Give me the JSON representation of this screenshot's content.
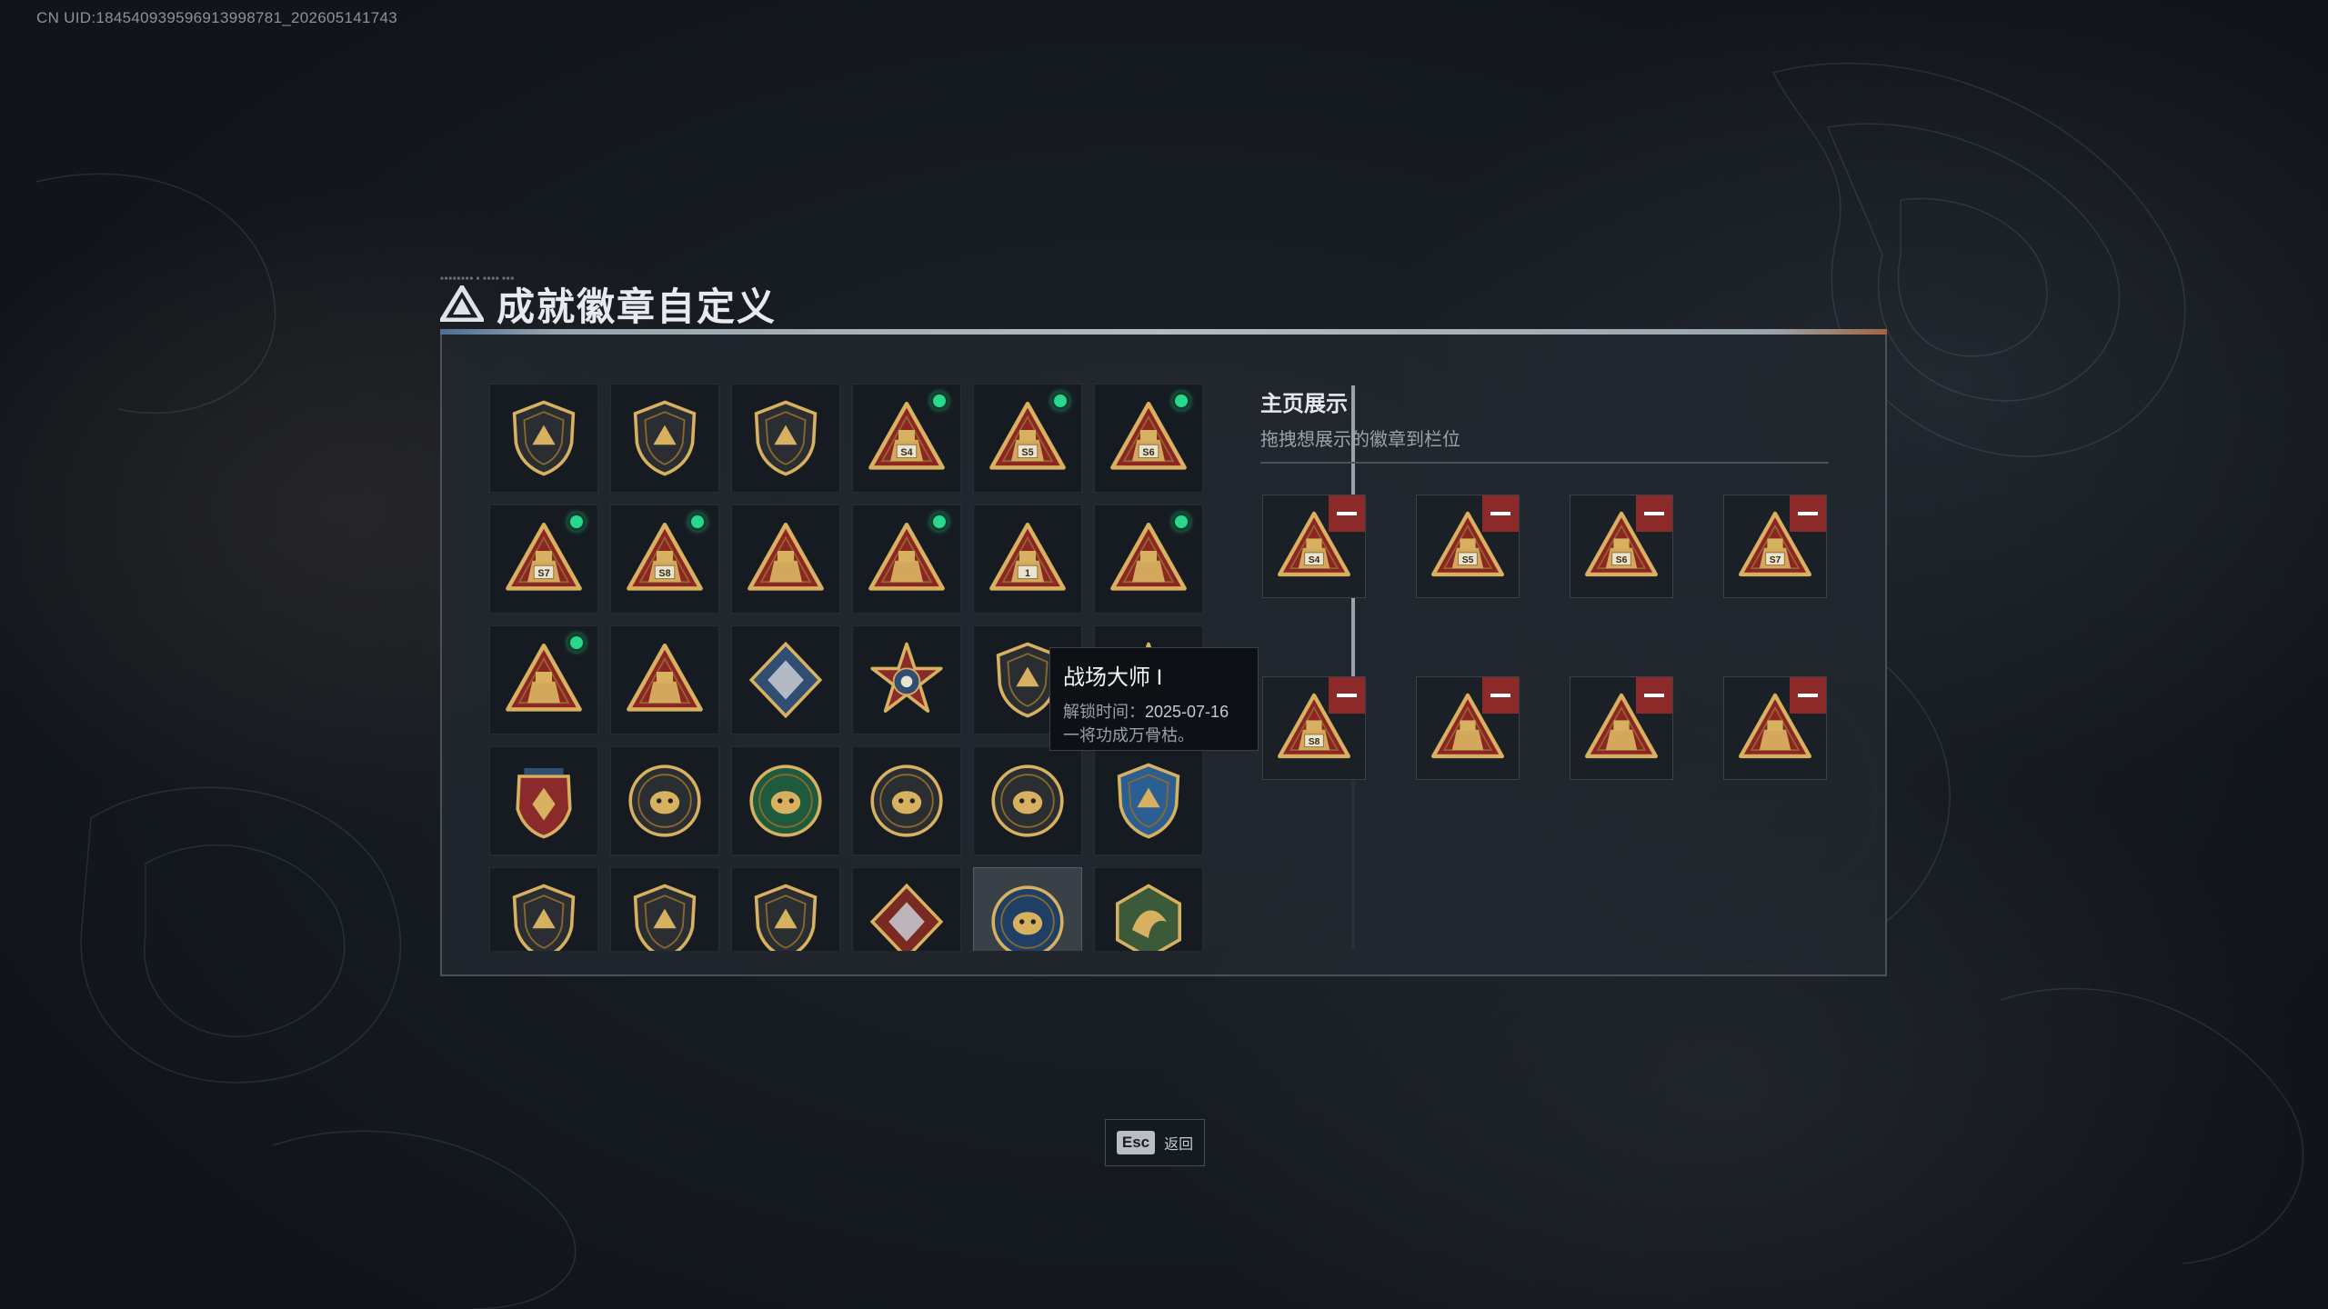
{
  "uid_text": "CN UID:18454093959691399​8781_202605141743",
  "header": {
    "title": "成就徽章自定义",
    "deco_text": "■■■■■■■■ ■ ■■■■ ■■■"
  },
  "colors": {
    "gold": "#d7b060",
    "gold_dark": "#8a6a2c",
    "red_tri": "#8f2424",
    "new_dot": "#27d88d",
    "remove_red": "#8c2a2a"
  },
  "badges": [
    {
      "icon": "shield-delta-icon",
      "new": false
    },
    {
      "icon": "shield-helicopter-icon",
      "new": false
    },
    {
      "icon": "shield-diamond-icon",
      "new": false
    },
    {
      "icon": "triangle-s4-icon",
      "label": "S4",
      "new": true
    },
    {
      "icon": "triangle-s5-icon",
      "label": "S5",
      "new": true
    },
    {
      "icon": "triangle-s6-icon",
      "label": "S6",
      "new": true
    },
    {
      "icon": "triangle-s7-icon",
      "label": "S7",
      "new": true
    },
    {
      "icon": "triangle-s8-icon",
      "label": "S8",
      "new": true
    },
    {
      "icon": "triangle-soldier-icon",
      "new": false
    },
    {
      "icon": "triangle-boat-icon",
      "new": true
    },
    {
      "icon": "triangle-number-one-icon",
      "label": "1",
      "new": false
    },
    {
      "icon": "triangle-crate-icon",
      "new": true
    },
    {
      "icon": "triangle-fighters-icon",
      "new": true
    },
    {
      "icon": "triangle-tower-icon",
      "new": false
    },
    {
      "icon": "diamond-gem-icon",
      "new": false
    },
    {
      "icon": "star-skull-icon",
      "new": false
    },
    {
      "icon": "shield-master-icon",
      "new": false
    },
    {
      "icon": "stars-emblem-icon",
      "new": false
    },
    {
      "icon": "crest-eagle-icon",
      "new": false
    },
    {
      "icon": "circle-helmet-icon",
      "new": false
    },
    {
      "icon": "circle-skull-green-icon",
      "new": false
    },
    {
      "icon": "circle-eye-icon",
      "new": false
    },
    {
      "icon": "circle-beast-icon",
      "new": false
    },
    {
      "icon": "shield-rifle-blue-icon",
      "new": false
    },
    {
      "icon": "shield-rifle-icon",
      "new": false
    },
    {
      "icon": "shield-sniper-icon",
      "new": false
    },
    {
      "icon": "shield-cross-gold-icon",
      "new": false
    },
    {
      "icon": "diamond-wolf-icon",
      "new": false
    },
    {
      "icon": "circle-eagle-icon",
      "new": false
    },
    {
      "icon": "hex-dragon-icon",
      "new": false
    }
  ],
  "selected_index": 28,
  "tooltip": {
    "name": "战场大师 I",
    "unlock_label": "解锁时间：",
    "unlock_date": "2025-07-16",
    "desc": "一将功成万骨枯。"
  },
  "showcase": {
    "title": "主页展示",
    "subtitle": "拖拽想展示的徽章到栏位",
    "slots": [
      {
        "icon": "triangle-s4-icon",
        "label": "S4"
      },
      {
        "icon": "triangle-s5-icon",
        "label": "S5"
      },
      {
        "icon": "triangle-s6-icon",
        "label": "S6"
      },
      {
        "icon": "triangle-s7-icon",
        "label": "S7"
      },
      {
        "icon": "triangle-s8-icon",
        "label": "S8"
      },
      {
        "icon": "triangle-crate-icon"
      },
      {
        "icon": "triangle-fighters-icon"
      },
      {
        "icon": "triangle-boat-icon"
      }
    ]
  },
  "footer": {
    "esc_key": "Esc",
    "esc_label": "返回"
  }
}
